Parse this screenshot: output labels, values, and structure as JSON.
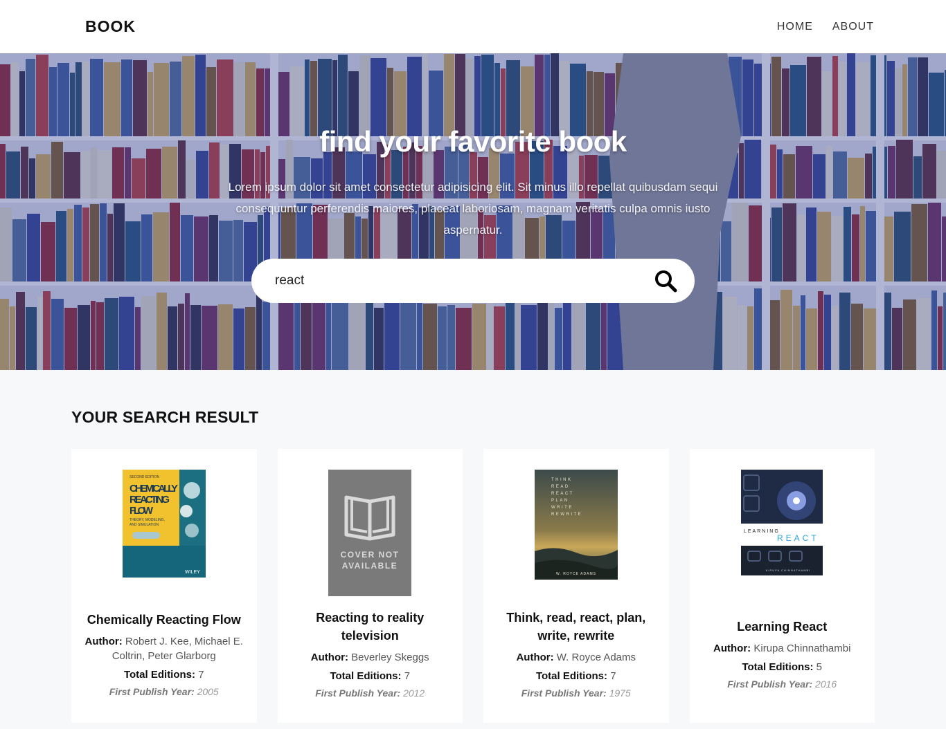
{
  "nav": {
    "brand": "BOOK",
    "links": [
      "HOME",
      "ABOUT"
    ]
  },
  "hero": {
    "title": "find your favorite book",
    "description": "Lorem ipsum dolor sit amet consectetur adipisicing elit. Sit minus illo repellat quibusdam sequi consequuntur perferendis maiores, placeat laboriosam, magnam veritatis culpa omnis iusto aspernatur.",
    "search_value": "react",
    "search_icon": "search-icon"
  },
  "results": {
    "title": "YOUR SEARCH RESULT",
    "author_label": "Author:",
    "editions_label": "Total Editions:",
    "year_label": "First Publish Year:",
    "books": [
      {
        "title": "Chemically Reacting Flow",
        "author": "Robert J. Kee, Michael E. Coltrin, Peter Glarborg",
        "editions": "7",
        "year": "2005",
        "cover_text": [
          "SECOND EDITION",
          "CHEMICALLY",
          "REACTING",
          "FLOW",
          "THEORY, MODELING,",
          "AND SIMULATION",
          "WILEY"
        ]
      },
      {
        "title": "Reacting to reality television",
        "author": "Beverley Skeggs",
        "editions": "7",
        "year": "2012",
        "cover_text": [
          "COVER NOT",
          "AVAILABLE"
        ]
      },
      {
        "title": "Think, read, react, plan, write, rewrite",
        "author": "W. Royce Adams",
        "editions": "7",
        "year": "1975",
        "cover_text": [
          "THINK",
          "READ",
          "REACT",
          "PLAN",
          "WRITE",
          "REWRITE",
          "W. ROYCE ADAMS"
        ]
      },
      {
        "title": "Learning React",
        "author": "Kirupa Chinnathambi",
        "editions": "5",
        "year": "2016",
        "cover_text": [
          "LEARNING",
          "REACT",
          "KIRUPA CHINNATHAMBI"
        ]
      }
    ]
  }
}
